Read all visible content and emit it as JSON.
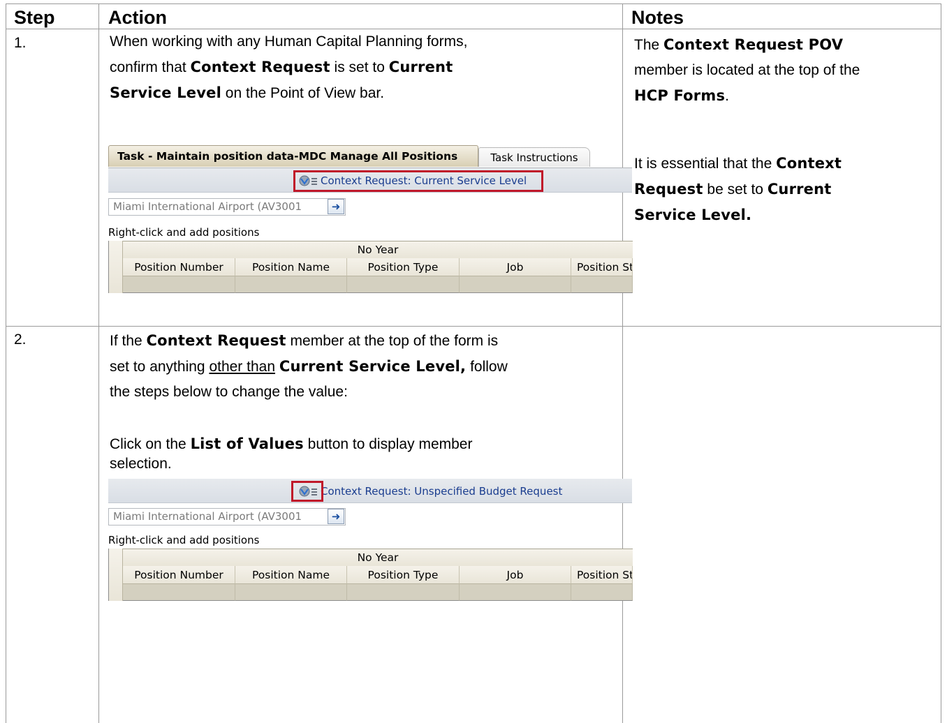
{
  "headers": {
    "step": "Step",
    "action": "Action",
    "notes": "Notes"
  },
  "row1": {
    "step": "1.",
    "action": {
      "t1": "When working with any Human Capital Planning forms,",
      "t2": "confirm that ",
      "b1": "Context Request",
      "t3": " is set to ",
      "b2": "Current",
      "b3": "Service Level",
      "t4": " on the Point of View bar."
    },
    "notes": {
      "p1_t1": "The ",
      "p1_b1": "Context Request POV",
      "p1_t2": "member is located at the top of the",
      "p1_b2": "HCP Forms",
      "p1_t3": ".",
      "p2_t1": "It is essential that the ",
      "p2_b1": "Context",
      "p2_b2": "Request",
      "p2_t2": " be set to ",
      "p2_b3": "Current",
      "p2_b4": "Service Level."
    },
    "screenshot": {
      "tab_active": "Task - Maintain position data-MDC Manage All Positions",
      "tab_inactive": "Task Instructions",
      "pov_label": "Context Request: Current Service Level",
      "entity_value": "Miami International Airport (AV3001",
      "hint": "Right-click and add positions",
      "group_header": "No Year",
      "columns": [
        "Position Number",
        "Position Name",
        "Position Type",
        "Job",
        "Position St"
      ]
    }
  },
  "row2": {
    "step": "2.",
    "action": {
      "t1": "If the ",
      "b1": "Context Request",
      "t2": " member at the top of the form is",
      "t3": "set to anything ",
      "u1": "other than",
      "t4": " ",
      "b2": "Current Service Level,",
      "t5": " follow",
      "t6": "the steps below to change the value:",
      "t7": "Click on the ",
      "b3": "List of Values",
      "t8": " button to display member",
      "t9": "selection."
    },
    "screenshot": {
      "pov_label": "Context Request: Unspecified Budget Request",
      "entity_value": "Miami International Airport (AV3001",
      "hint": "Right-click and add positions",
      "group_header": "No Year",
      "columns": [
        "Position Number",
        "Position Name",
        "Position Type",
        "Job",
        "Position St"
      ]
    }
  },
  "colors": {
    "highlight": "#c0182a",
    "pov_text": "#1a3d8f"
  },
  "icons": {
    "pov_member": "member-list-icon",
    "go": "arrow-right-icon",
    "dropdown": "chevron-down-icon"
  }
}
